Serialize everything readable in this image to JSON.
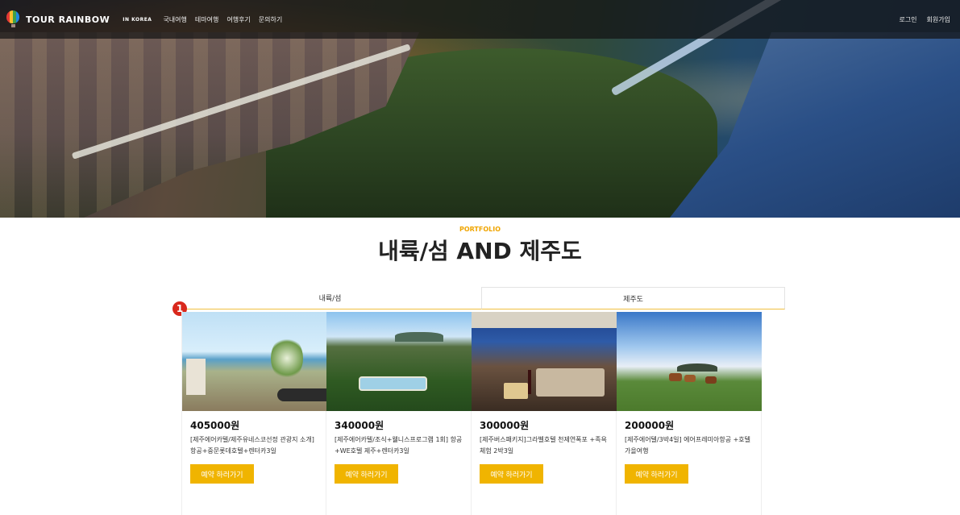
{
  "nav": {
    "brand": "TOUR RAINBOW",
    "brand_sub": "IN KOREA",
    "menu": [
      "국내여행",
      "테마여행",
      "여행후기",
      "문의하기"
    ],
    "login": "로그인",
    "signup": "회원가입"
  },
  "section": {
    "eyebrow": "PORTFOLIO",
    "title": "내륙/섬 AND 제주도"
  },
  "tabs": [
    "내륙/섬",
    "제주도"
  ],
  "marker": "1",
  "cards": [
    {
      "price": "405000원",
      "desc": "[제주에어카텔/제주유네스코선정 관광지 소개] 항공+중문롯데호텔+렌터카3일",
      "button": "예약 하러가기"
    },
    {
      "price": "340000원",
      "desc": "[제주에어카텔/조식+웰니스프로그램 1회] 항공+WE호텔 제주+렌터카3일",
      "button": "예약 하러가기"
    },
    {
      "price": "300000원",
      "desc": "[제주버스패키지]그라벨호텔 천제연폭포 +족욕체험 2박3일",
      "button": "예약 하러가기"
    },
    {
      "price": "200000원",
      "desc": "[제주에어텔/3박4일] 에어프레미아항공 +호텔 가을여행",
      "button": "예약 하러가기"
    }
  ],
  "colors": {
    "accent": "#f0b400",
    "eyebrow": "#f0a500",
    "marker": "#d9281c"
  }
}
